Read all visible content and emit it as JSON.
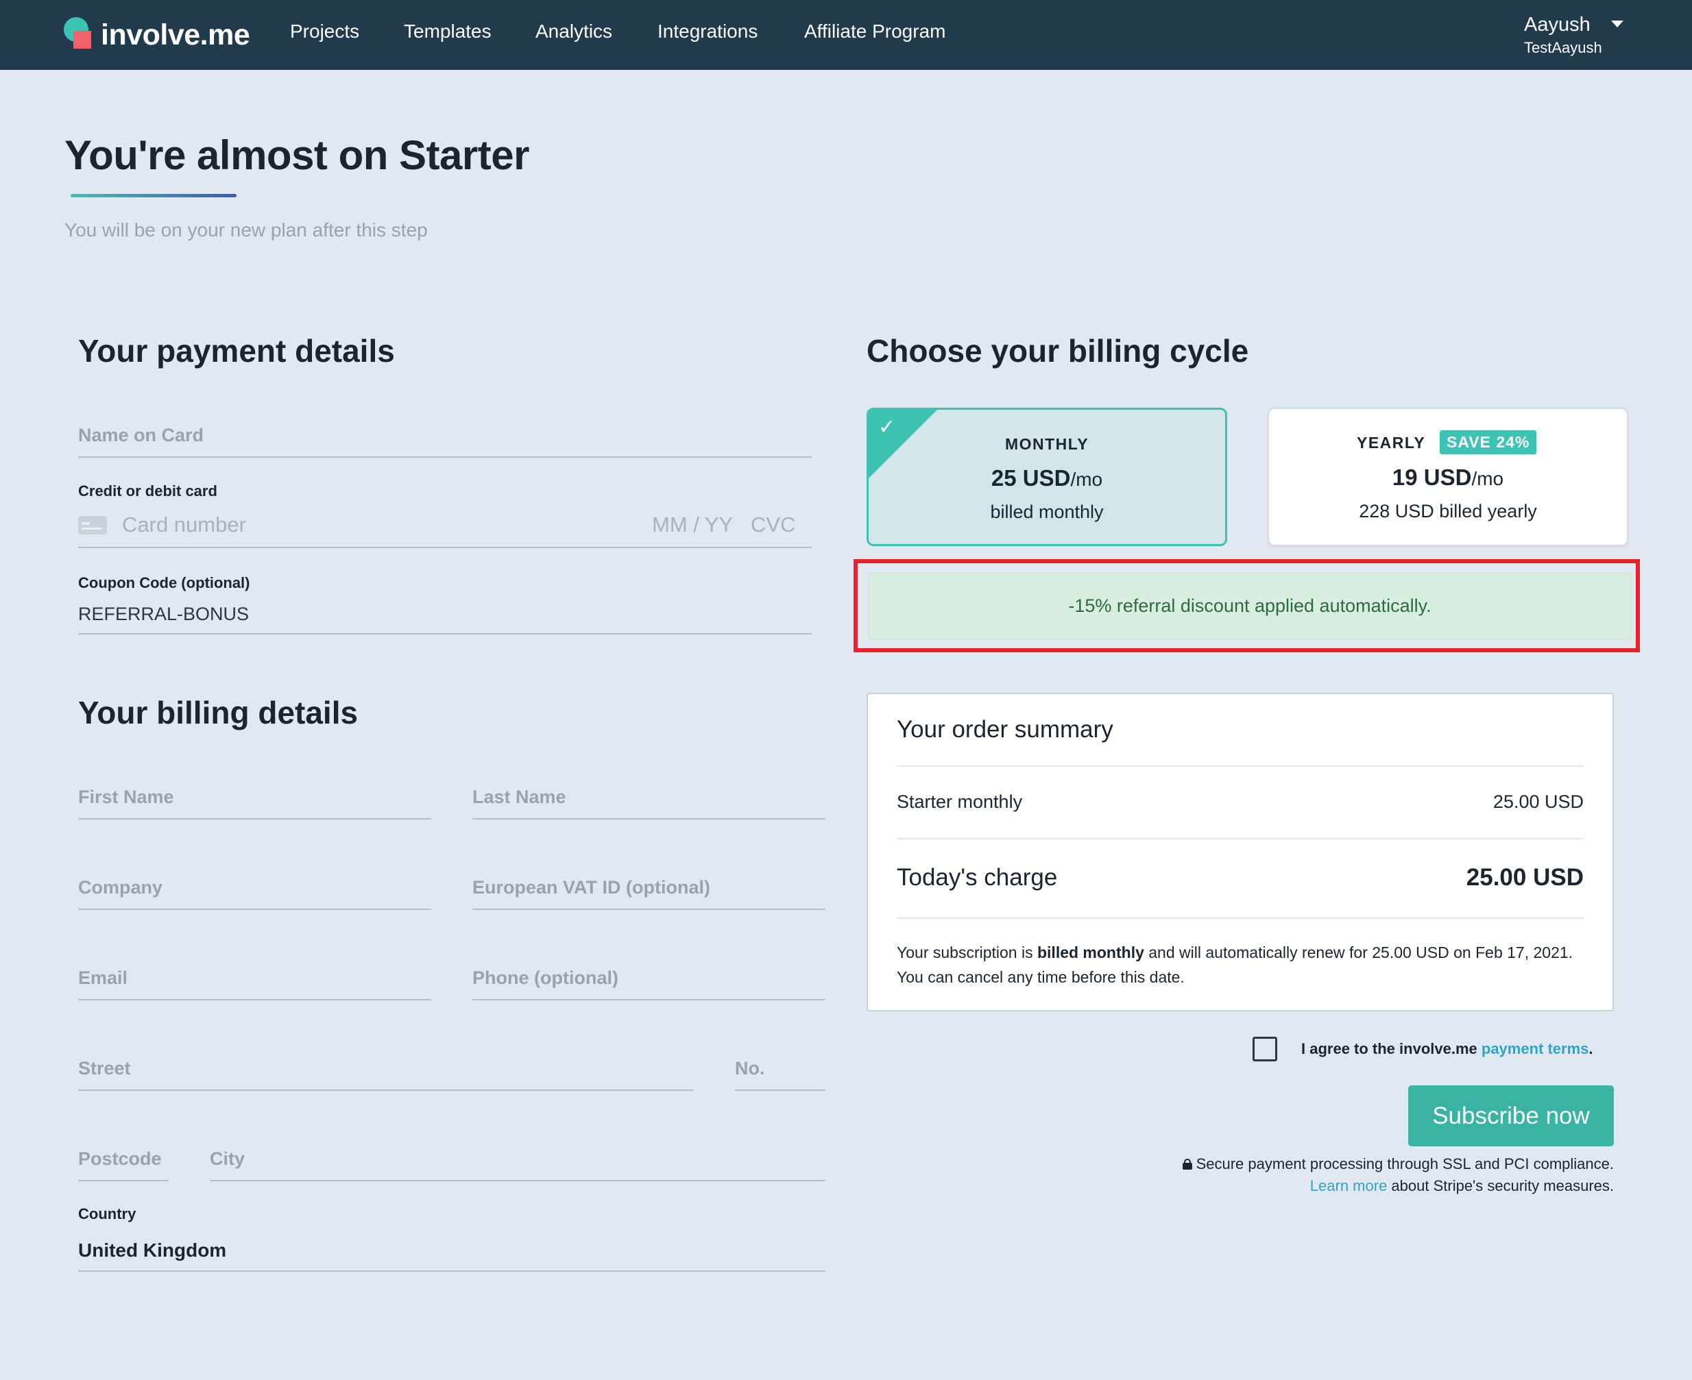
{
  "nav": {
    "logo_text": "involve.me",
    "items": [
      "Projects",
      "Templates",
      "Analytics",
      "Integrations",
      "Affiliate Program"
    ],
    "user_name": "Aayush",
    "user_account": "TestAayush"
  },
  "header": {
    "title": "You're almost on Starter",
    "subtitle": "You will be on your new plan after this step"
  },
  "payment": {
    "title": "Your payment details",
    "name_on_card_placeholder": "Name on Card",
    "card_label": "Credit or debit card",
    "card_number_placeholder": "Card number",
    "expiry_placeholder": "MM / YY",
    "cvc_placeholder": "CVC",
    "coupon_label": "Coupon Code (optional)",
    "coupon_value": "REFERRAL-BONUS"
  },
  "billing": {
    "title": "Your billing details",
    "first_name": "First Name",
    "last_name": "Last Name",
    "company": "Company",
    "vat": "European VAT ID (optional)",
    "email": "Email",
    "phone": "Phone (optional)",
    "street": "Street",
    "number": "No.",
    "postcode": "Postcode",
    "city": "City",
    "country_label": "Country",
    "country_value": "United Kingdom"
  },
  "cycle": {
    "title": "Choose your billing cycle",
    "monthly": {
      "name": "MONTHLY",
      "price": "25 USD",
      "per": "/mo",
      "billed": "billed monthly",
      "selected": true
    },
    "yearly": {
      "name": "YEARLY",
      "badge": "SAVE 24%",
      "price": "19 USD",
      "per": "/mo",
      "billed": "228 USD billed yearly",
      "selected": false
    }
  },
  "discount": {
    "text": "-15% referral discount applied automatically.",
    "highlight_color": "#e8222b"
  },
  "summary": {
    "title": "Your order summary",
    "line_label": "Starter monthly",
    "line_value": "25.00 USD",
    "charge_label": "Today's charge",
    "charge_value": "25.00 USD",
    "note_pre": "Your subscription is ",
    "note_bold": "billed monthly",
    "note_post": " and will automatically renew for 25.00 USD on Feb 17, 2021. You can cancel any time before this date."
  },
  "agree": {
    "text": "I agree to the involve.me ",
    "link": "payment terms",
    "suffix": ".",
    "checked": false
  },
  "subscribe": {
    "label": "Subscribe now",
    "secure_text": "Secure payment processing through SSL and PCI compliance.",
    "learn_link": "Learn more",
    "learn_text": " about Stripe's security measures."
  },
  "colors": {
    "navbar": "#213b4d",
    "accent": "#3cc3b4",
    "background": "#e2e8f1",
    "link": "#2fa3c9"
  }
}
